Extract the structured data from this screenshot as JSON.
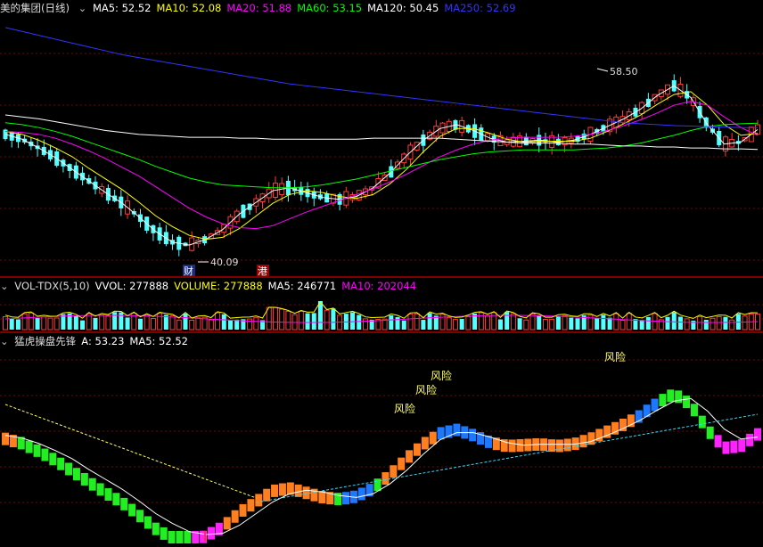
{
  "price_panel": {
    "title": "美的集团(日线)",
    "ma": [
      {
        "label": "MA5: 52.52",
        "color": "#ffffff"
      },
      {
        "label": "MA10: 52.08",
        "color": "#ffff00"
      },
      {
        "label": "MA20: 51.88",
        "color": "#ff00ff"
      },
      {
        "label": "MA60: 53.15",
        "color": "#00ff00"
      },
      {
        "label": "MA120: 50.45",
        "color": "#ffffff"
      },
      {
        "label": "MA250: 52.69",
        "color": "#3333ff"
      }
    ],
    "high_label": "58.50",
    "low_label": "40.09",
    "marker_cai": "财",
    "marker_gang": "港"
  },
  "volume_panel": {
    "items": [
      {
        "label": "VOL-TDX(5,10)",
        "color": "#dddddd"
      },
      {
        "label": "VVOL: 277888",
        "color": "#ffffff"
      },
      {
        "label": "VOLUME: 277888",
        "color": "#ffff00"
      },
      {
        "label": "MA5: 246771",
        "color": "#ffffff"
      },
      {
        "label": "MA10: 202044",
        "color": "#ff00ff"
      }
    ]
  },
  "indicator_panel": {
    "items": [
      {
        "label": "猛虎操盘先锋",
        "color": "#dddddd"
      },
      {
        "label": "A: 53.23",
        "color": "#ffffff"
      },
      {
        "label": "MA5: 52.52",
        "color": "#ffffff"
      }
    ],
    "risk_label": "风险"
  },
  "chart_data": {
    "type": "line",
    "title": "美的集团(日线)",
    "x": [
      0,
      4,
      8,
      12,
      16,
      20,
      24,
      28,
      32,
      36,
      40,
      44,
      48,
      52,
      56,
      60,
      64,
      68,
      72,
      76,
      80,
      84,
      88,
      92,
      96,
      100,
      104,
      108,
      112,
      116,
      120,
      124,
      128,
      132,
      136,
      140,
      144,
      148,
      152,
      156,
      160,
      164,
      168,
      172,
      176,
      180
    ],
    "series": [
      {
        "name": "MA5",
        "color": "#ffffff",
        "values": [
          52.0,
          51.5,
          50.6,
          49.6,
          48.4,
          47.2,
          46.0,
          44.9,
          43.5,
          42.0,
          40.9,
          40.6,
          41.2,
          42.2,
          43.8,
          45.0,
          46.2,
          46.5,
          46.0,
          45.5,
          45.3,
          45.6,
          46.5,
          48.0,
          49.8,
          51.4,
          52.6,
          53.0,
          52.4,
          51.6,
          51.2,
          51.3,
          51.4,
          51.2,
          51.4,
          52.0,
          52.8,
          53.6,
          54.6,
          56.0,
          57.0,
          55.8,
          53.0,
          51.0,
          51.2,
          52.5
        ]
      },
      {
        "name": "MA10",
        "color": "#ffff00",
        "values": [
          52.3,
          52.0,
          51.4,
          50.6,
          49.7,
          48.5,
          47.4,
          46.3,
          45.0,
          43.6,
          42.5,
          41.6,
          41.2,
          41.4,
          42.3,
          43.6,
          44.9,
          45.8,
          46.2,
          46.0,
          45.6,
          45.4,
          45.8,
          46.9,
          48.4,
          50.2,
          51.8,
          52.6,
          52.6,
          52.1,
          51.5,
          51.2,
          51.3,
          51.3,
          51.3,
          51.6,
          52.3,
          53.1,
          54.0,
          55.1,
          56.1,
          56.4,
          55.0,
          53.0,
          51.9,
          52.1
        ]
      },
      {
        "name": "MA20",
        "color": "#ff00ff",
        "values": [
          52.3,
          52.2,
          52.0,
          51.6,
          51.0,
          50.3,
          49.5,
          48.6,
          47.7,
          46.6,
          45.5,
          44.4,
          43.5,
          42.8,
          42.4,
          42.3,
          42.6,
          43.3,
          44.0,
          44.6,
          45.2,
          45.8,
          46.4,
          47.1,
          47.9,
          48.8,
          49.7,
          50.4,
          51.0,
          51.4,
          51.6,
          51.7,
          51.7,
          51.7,
          51.8,
          52.0,
          52.4,
          52.9,
          53.5,
          54.2,
          55.0,
          55.4,
          55.0,
          53.8,
          52.7,
          51.9
        ]
      },
      {
        "name": "MA60",
        "color": "#00ff00",
        "values": [
          53.2,
          53.0,
          52.7,
          52.3,
          51.8,
          51.2,
          50.6,
          50.0,
          49.4,
          48.7,
          48.1,
          47.5,
          47.1,
          46.8,
          46.7,
          46.6,
          46.5,
          46.5,
          46.6,
          46.8,
          47.1,
          47.4,
          47.8,
          48.2,
          48.6,
          49.0,
          49.4,
          49.7,
          50.0,
          50.2,
          50.3,
          50.4,
          50.4,
          50.4,
          50.4,
          50.5,
          50.6,
          50.8,
          51.1,
          51.5,
          51.9,
          52.4,
          52.8,
          53.0,
          53.1,
          53.15
        ]
      },
      {
        "name": "MA120",
        "color": "#ffffff",
        "values": [
          54.0,
          53.8,
          53.6,
          53.3,
          53.0,
          52.7,
          52.4,
          52.2,
          52.0,
          51.9,
          51.8,
          51.7,
          51.7,
          51.7,
          51.6,
          51.6,
          51.5,
          51.5,
          51.5,
          51.5,
          51.5,
          51.5,
          51.6,
          51.6,
          51.6,
          51.6,
          51.6,
          51.5,
          51.4,
          51.3,
          51.2,
          51.1,
          51.1,
          51.1,
          51.0,
          51.0,
          50.9,
          50.8,
          50.8,
          50.7,
          50.7,
          50.6,
          50.6,
          50.5,
          50.5,
          50.45
        ]
      },
      {
        "name": "MA250",
        "color": "#3333ff",
        "values": [
          63.0,
          62.6,
          62.2,
          61.8,
          61.4,
          61.0,
          60.6,
          60.2,
          59.9,
          59.6,
          59.3,
          59.0,
          58.7,
          58.4,
          58.1,
          57.8,
          57.5,
          57.2,
          57.0,
          56.8,
          56.6,
          56.4,
          56.2,
          56.0,
          55.8,
          55.6,
          55.4,
          55.2,
          55.0,
          54.8,
          54.6,
          54.4,
          54.2,
          54.0,
          53.8,
          53.6,
          53.4,
          53.2,
          53.1,
          53.0,
          52.9,
          52.85,
          52.8,
          52.75,
          52.7,
          52.69
        ]
      }
    ],
    "ylim": [
      38.5,
      64.0
    ]
  }
}
